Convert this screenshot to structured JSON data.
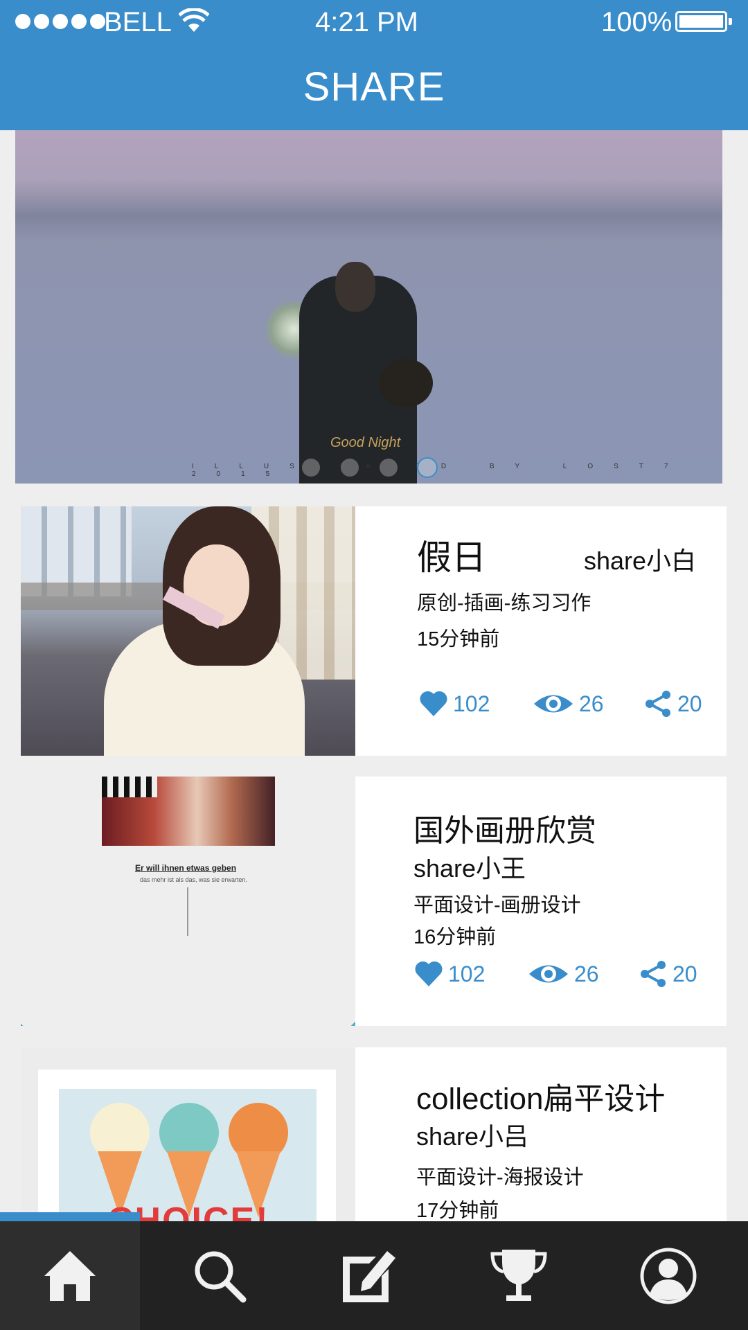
{
  "status_bar": {
    "carrier": "BELL",
    "time": "4:21 PM",
    "battery": "100%"
  },
  "header": {
    "title": "SHARE"
  },
  "banner": {
    "signature": "Good Night",
    "credit": "ILLUSTRATED BY LOST7 2015",
    "page_count": 4,
    "active_page": 4
  },
  "posts": [
    {
      "title": "假日",
      "author": "share小白",
      "category": "原创-插画-练习习作",
      "time": "15分钟前",
      "likes": "102",
      "views": "26",
      "shares": "20"
    },
    {
      "title": "国外画册欣赏",
      "author": "share小王",
      "category": "平面设计-画册设计",
      "time": "16分钟前",
      "likes": "102",
      "views": "26",
      "shares": "20",
      "thumb_caption": "Er will ihnen etwas geben",
      "thumb_subcaption": "das mehr ist als das, was sie erwarten."
    },
    {
      "title": "collection扁平设计",
      "author": "share小吕",
      "category": "平面设计-海报设计",
      "time": "17分钟前",
      "thumb_text": "CHOICE!"
    }
  ],
  "tabbar": {
    "items": [
      "home",
      "search",
      "compose",
      "trophy",
      "profile"
    ],
    "active": "home"
  },
  "colors": {
    "accent": "#3a8dcb",
    "tabbar": "#222222",
    "background": "#eeeeee"
  }
}
